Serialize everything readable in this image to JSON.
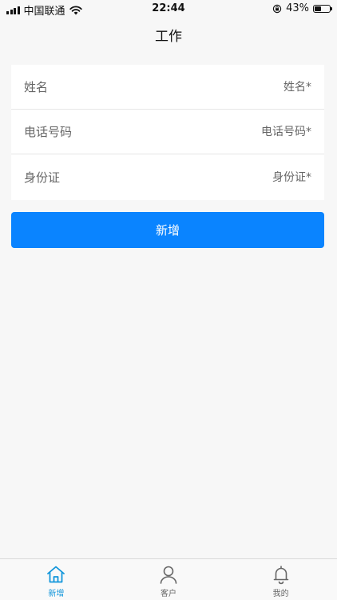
{
  "status_bar": {
    "carrier": "中国联通",
    "time": "22:44",
    "battery": "43%",
    "battery_level": 0.43
  },
  "nav": {
    "title": "工作"
  },
  "form": {
    "fields": [
      {
        "label": "姓名",
        "placeholder": "姓名*"
      },
      {
        "label": "电话号码",
        "placeholder": "电话号码*"
      },
      {
        "label": "身份证",
        "placeholder": "身份证*"
      }
    ],
    "submit_label": "新增"
  },
  "tab_bar": {
    "tabs": [
      {
        "label": "新增",
        "icon": "home-icon",
        "active": true
      },
      {
        "label": "客户",
        "icon": "user-icon",
        "active": false
      },
      {
        "label": "我的",
        "icon": "bell-icon",
        "active": false
      }
    ]
  },
  "colors": {
    "accent": "#0a84ff",
    "tab_active": "#1296db",
    "background": "#f7f7f7"
  }
}
